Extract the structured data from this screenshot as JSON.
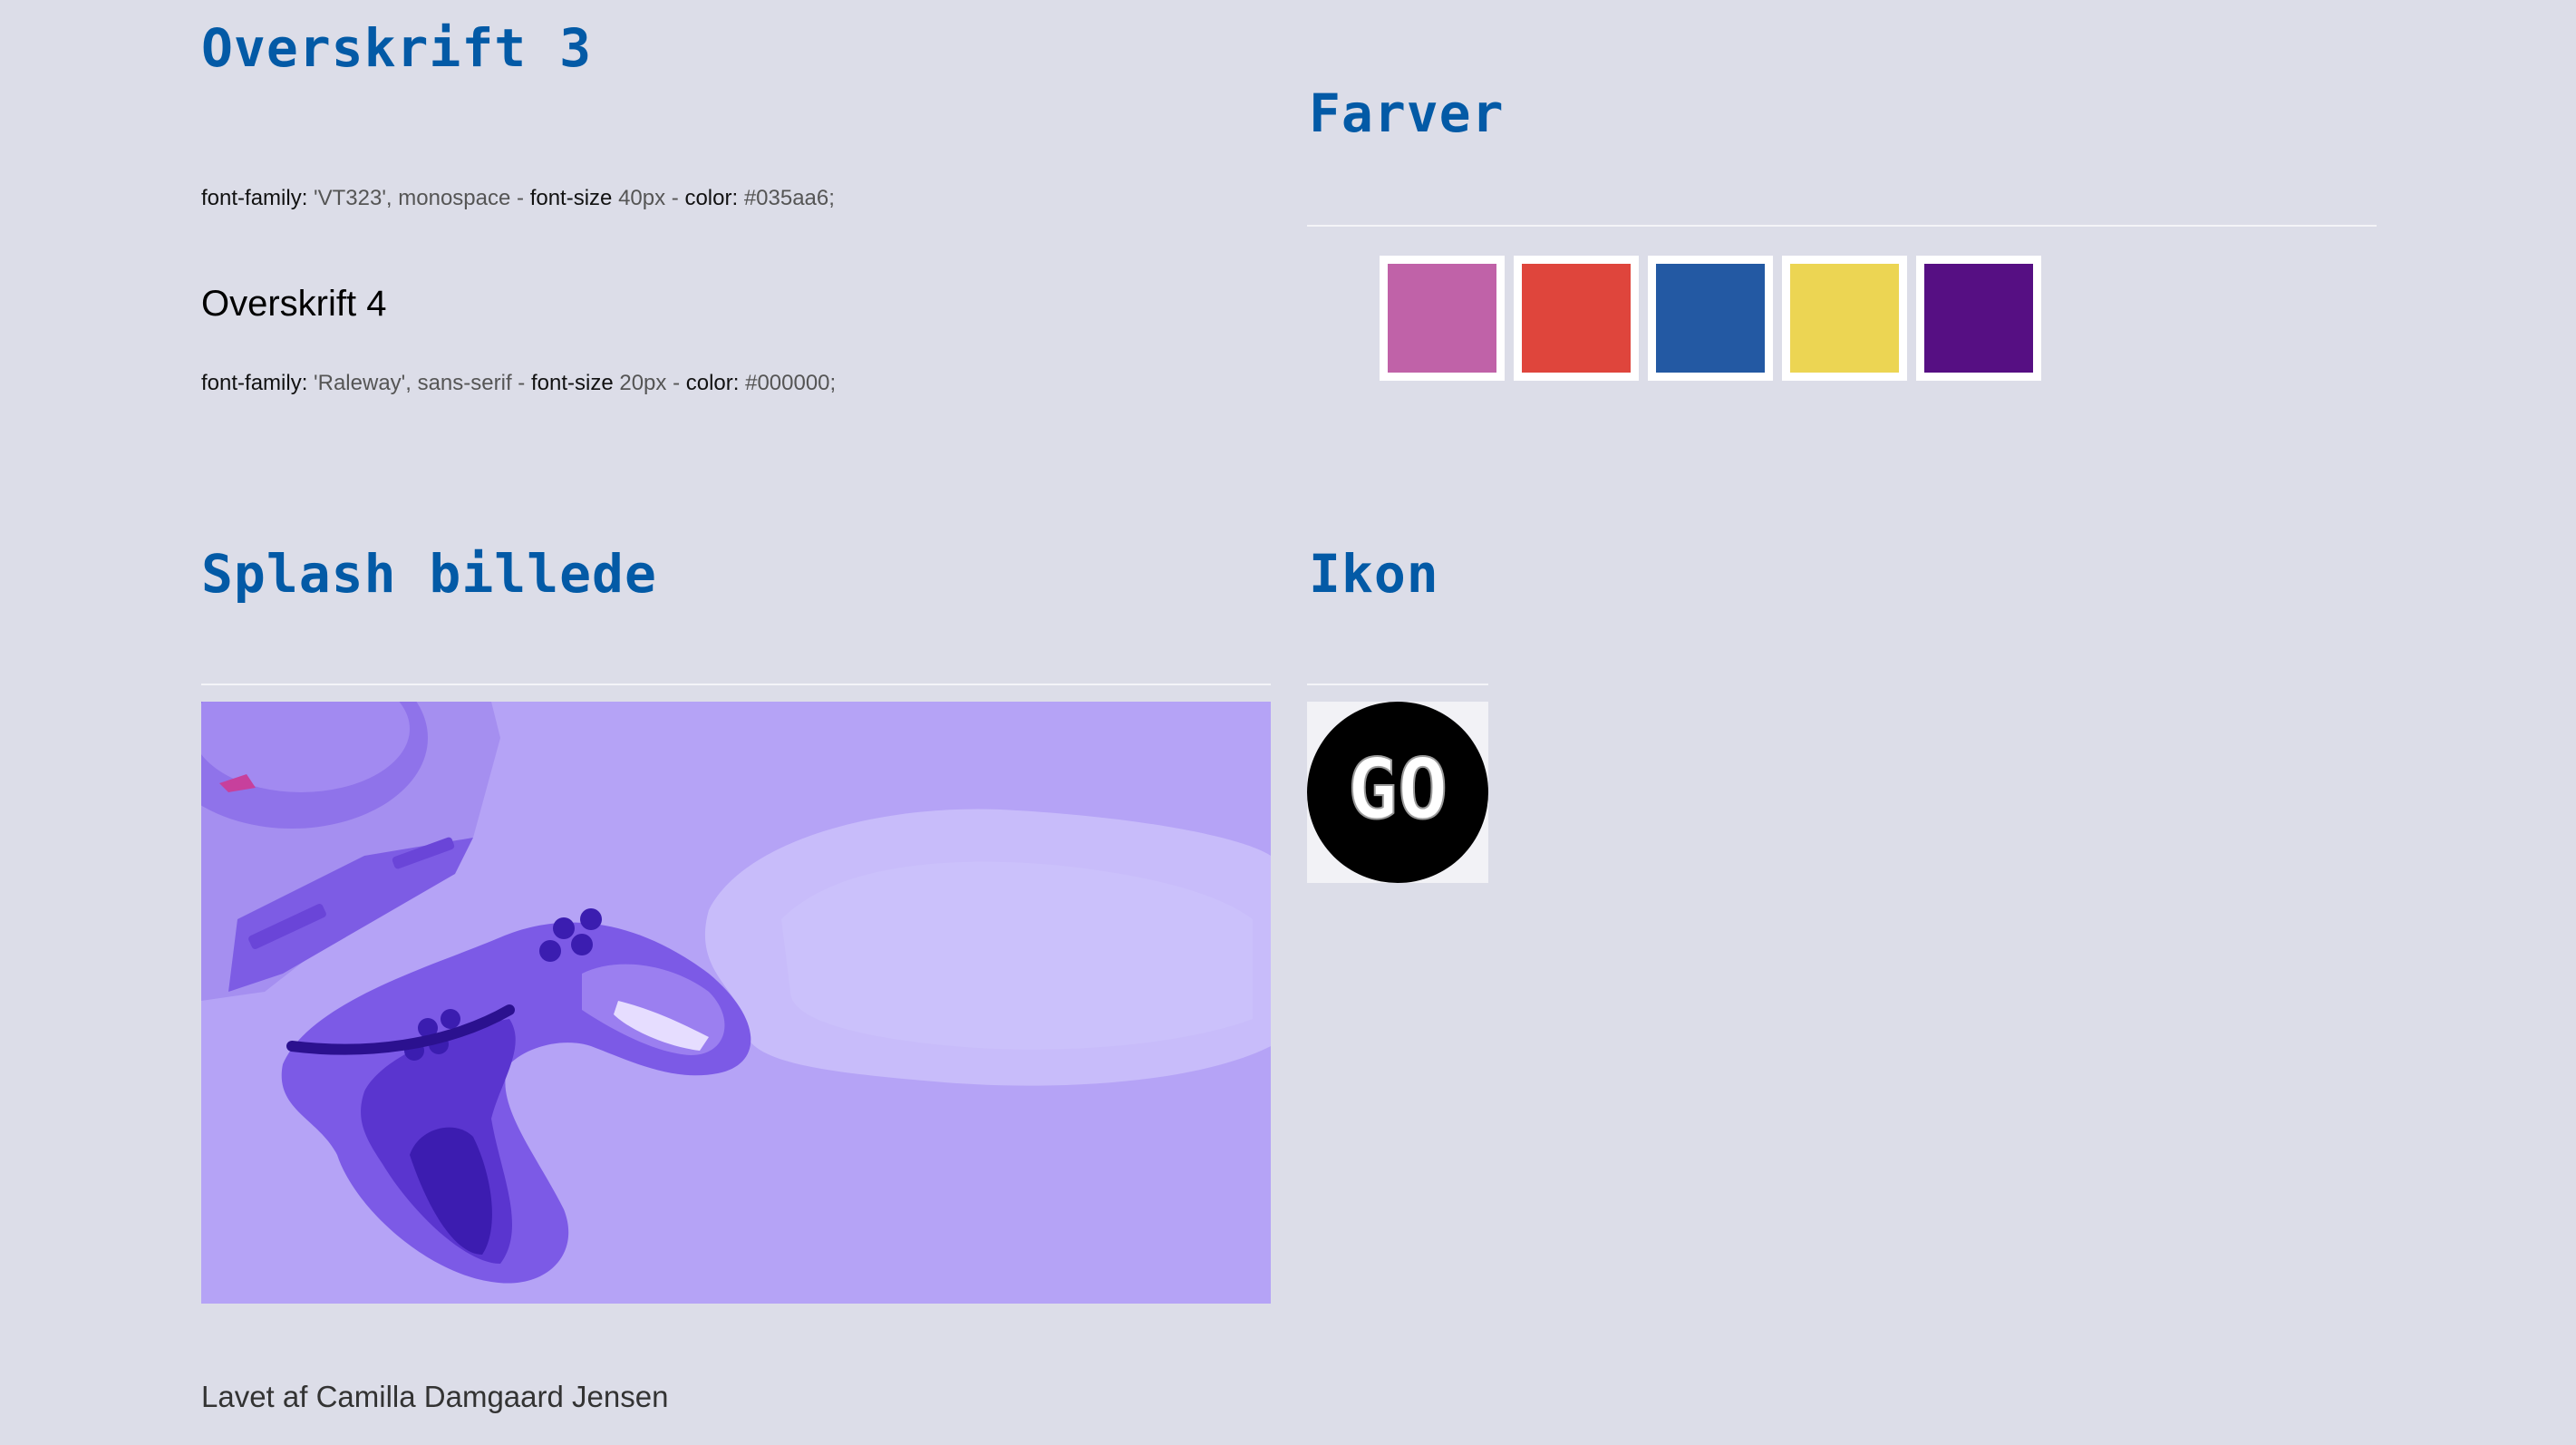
{
  "heading3": {
    "title": "Overskrift 3",
    "spec": {
      "family_label": "font-family:",
      "family_value": "'VT323', monospace",
      "sep1": "-",
      "size_label": "font-size",
      "size_value": "40px",
      "sep2": "-",
      "color_label": "color:",
      "color_value": "#035aa6;"
    }
  },
  "heading4": {
    "title": "Overskrift 4",
    "spec": {
      "family_label": "font-family:",
      "family_value": "'Raleway', sans-serif",
      "sep1": "-",
      "size_label": "font-size",
      "size_value": "20px",
      "sep2": "-",
      "color_label": "color:",
      "color_value": "#000000;"
    }
  },
  "colors": {
    "title": "Farver",
    "swatches": [
      "#c062a8",
      "#df453c",
      "#2359a3",
      "#ecd553",
      "#560f83"
    ]
  },
  "splash": {
    "title": "Splash billede"
  },
  "icon": {
    "title": "Ikon",
    "logo_text": "GO"
  },
  "footer": {
    "text": "Lavet af Camilla Damgaard Jensen"
  }
}
